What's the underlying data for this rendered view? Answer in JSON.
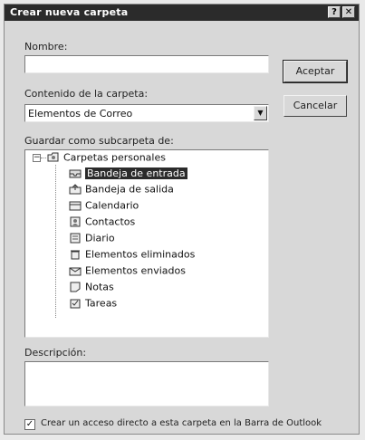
{
  "dialog": {
    "title": "Crear nueva carpeta",
    "help_btn": "?",
    "close_btn": "✕"
  },
  "name": {
    "label": "Nombre:",
    "value": ""
  },
  "contents": {
    "label": "Contenido de la carpeta:",
    "selected": "Elementos de Correo"
  },
  "save_as": {
    "label": "Guardar como subcarpeta de:"
  },
  "tree": {
    "root": {
      "expander": "−",
      "label": "Carpetas personales"
    },
    "items": [
      {
        "label": "Bandeja de entrada",
        "icon": "inbox-icon"
      },
      {
        "label": "Bandeja de salida",
        "icon": "outbox-icon"
      },
      {
        "label": "Calendario",
        "icon": "calendar-icon"
      },
      {
        "label": "Contactos",
        "icon": "contacts-icon"
      },
      {
        "label": "Diario",
        "icon": "journal-icon"
      },
      {
        "label": "Elementos eliminados",
        "icon": "deleted-items-icon"
      },
      {
        "label": "Elementos enviados",
        "icon": "sent-items-icon"
      },
      {
        "label": "Notas",
        "icon": "notes-icon"
      },
      {
        "label": "Tareas",
        "icon": "tasks-icon"
      }
    ],
    "selected_index": 0
  },
  "description": {
    "label": "Descripción:",
    "value": ""
  },
  "buttons": {
    "ok": "Aceptar",
    "cancel": "Cancelar"
  },
  "shortcut": {
    "checked": true,
    "check_mark": "✓",
    "label": "Crear un acceso directo a esta carpeta en la Barra de Outlook"
  },
  "colors": {
    "titlebar": "#2b2b2b",
    "dialog_bg": "#d8d8d8",
    "selection": "#2b2b2b"
  }
}
